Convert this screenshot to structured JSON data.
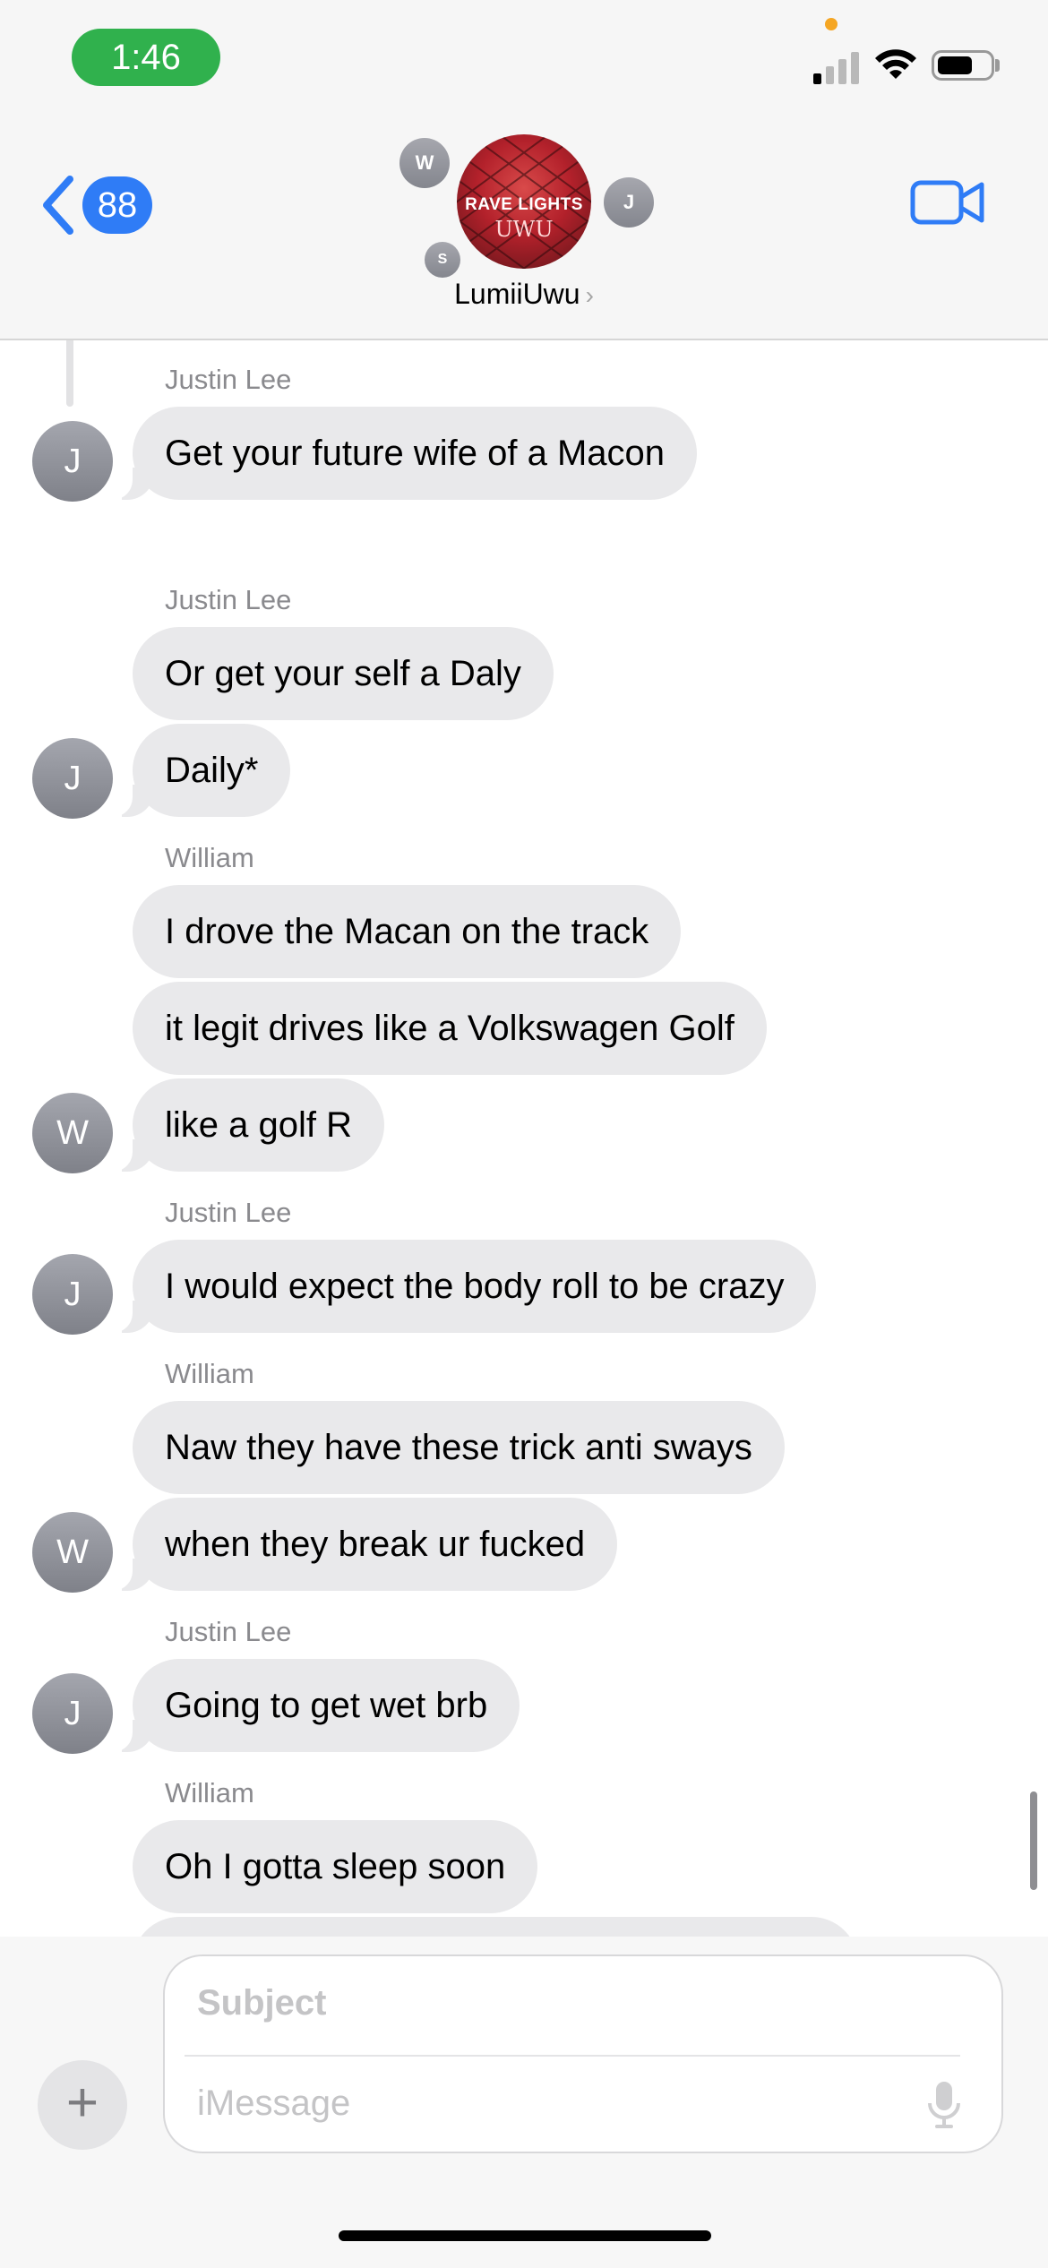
{
  "status_bar": {
    "time": "1:46"
  },
  "header": {
    "back_count": "88",
    "group_name": "LumiiUwu",
    "avatar_text_1": "RAVE LIGHTS",
    "avatar_text_2": "UWU",
    "member_initials": [
      "W",
      "J",
      "S"
    ]
  },
  "messages": [
    {
      "sender": "Justin Lee",
      "text": "Get your future wife of a Macon",
      "initial": "J"
    },
    {
      "sender": "Justin Lee",
      "text": "Or get your self a Daly"
    },
    {
      "text": "Daily*",
      "initial": "J"
    },
    {
      "sender": "William",
      "text": "I drove the Macan on the track"
    },
    {
      "text": "it legit drives like a Volkswagen Golf"
    },
    {
      "text": "like a golf R",
      "initial": "W"
    },
    {
      "sender": "Justin Lee",
      "text": "I would expect the body roll to be crazy",
      "initial": "J"
    },
    {
      "sender": "William",
      "text": "Naw they have these trick anti sways"
    },
    {
      "text": "when they break ur fucked",
      "initial": "W"
    },
    {
      "sender": "Justin Lee",
      "text": "Going to get wet brb",
      "initial": "J"
    },
    {
      "sender": "William",
      "text": "Oh I gotta sleep soon"
    }
  ],
  "compose": {
    "subject_placeholder": "Subject",
    "message_placeholder": "iMessage"
  },
  "colors": {
    "accent": "#2f7cf6",
    "bubble": "#e9e9eb",
    "time_pill": "#30b14d"
  }
}
